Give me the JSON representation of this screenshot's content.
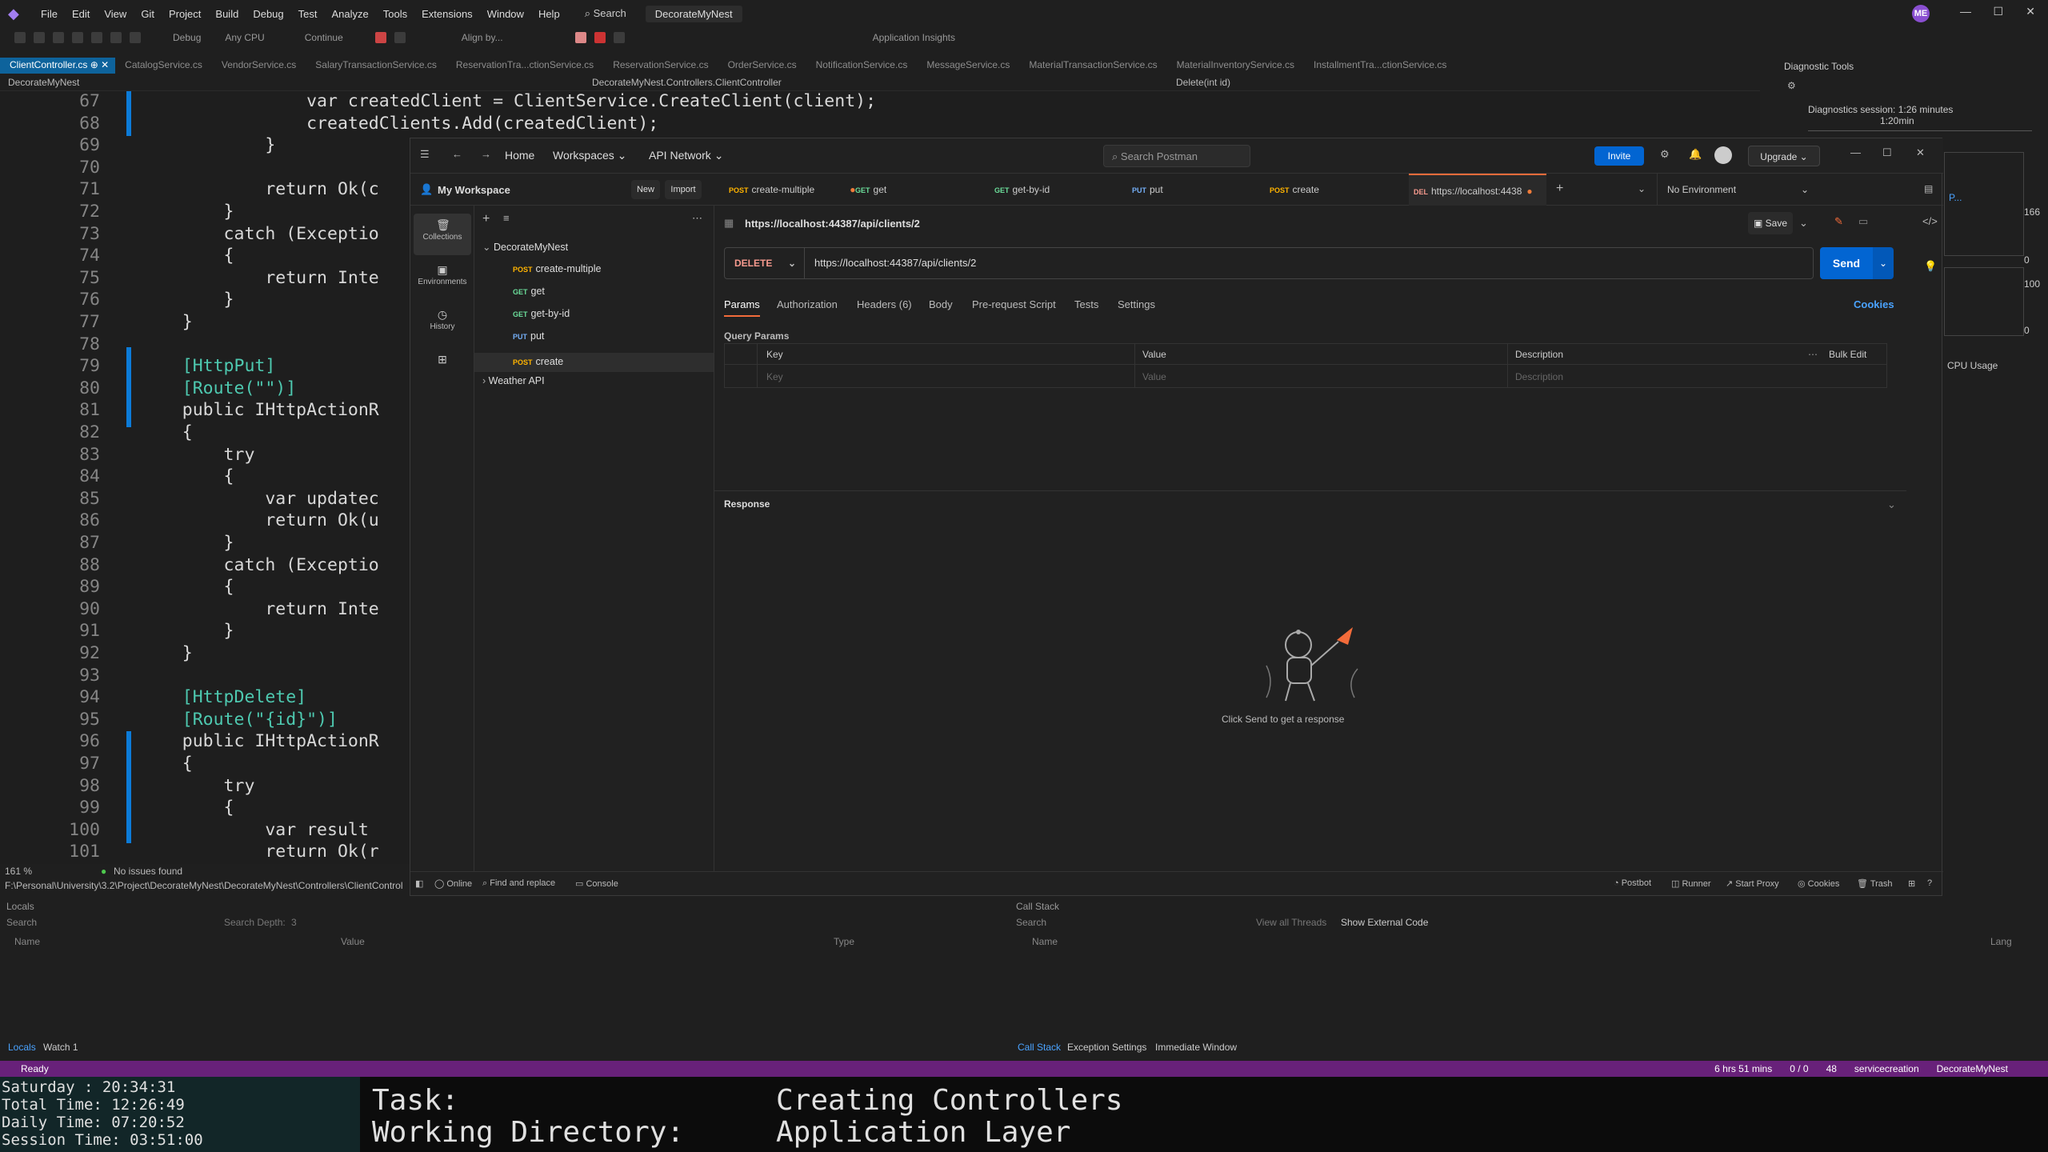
{
  "menu": {
    "items": [
      "File",
      "Edit",
      "View",
      "Git",
      "Project",
      "Build",
      "Debug",
      "Test",
      "Analyze",
      "Tools",
      "Extensions",
      "Window",
      "Help"
    ],
    "search": "Search",
    "solution": "DecorateMyNest",
    "user_initials": "ME"
  },
  "toolbar": {
    "config": "Debug",
    "platform": "Any CPU",
    "continue": "Continue",
    "align": "Align by...",
    "insights": "Application Insights"
  },
  "doc_tabs": [
    "ClientController.cs",
    "CatalogService.cs",
    "VendorService.cs",
    "SalaryTransactionService.cs",
    "ReservationTra...ctionService.cs",
    "ReservationService.cs",
    "OrderService.cs",
    "NotificationService.cs",
    "MessageService.cs",
    "MaterialTransactionService.cs",
    "MaterialInventoryService.cs",
    "InstallmentTra...ctionService.cs"
  ],
  "navbar": {
    "project": "DecorateMyNest",
    "class": "DecorateMyNest.Controllers.ClientController",
    "member": "Delete(int id)"
  },
  "editor": {
    "lines": [
      {
        "n": "67",
        "t": "                var createdClient = ClientService.CreateClient(client);"
      },
      {
        "n": "68",
        "t": "                createdClients.Add(createdClient);"
      },
      {
        "n": "69",
        "t": "            }"
      },
      {
        "n": "70",
        "t": ""
      },
      {
        "n": "71",
        "t": "            return Ok(c"
      },
      {
        "n": "72",
        "t": "        }"
      },
      {
        "n": "73",
        "t": "        catch (Exceptio"
      },
      {
        "n": "74",
        "t": "        {"
      },
      {
        "n": "75",
        "t": "            return Inte"
      },
      {
        "n": "76",
        "t": "        }"
      },
      {
        "n": "77",
        "t": "    }"
      },
      {
        "n": "78",
        "t": ""
      },
      {
        "n": "79",
        "t": "    [HttpPut]"
      },
      {
        "n": "80",
        "t": "    [Route(\"\")]"
      },
      {
        "n": "81",
        "t": "    public IHttpActionR"
      },
      {
        "n": "82",
        "t": "    {"
      },
      {
        "n": "83",
        "t": "        try"
      },
      {
        "n": "84",
        "t": "        {"
      },
      {
        "n": "85",
        "t": "            var updatec"
      },
      {
        "n": "86",
        "t": "            return Ok(u"
      },
      {
        "n": "87",
        "t": "        }"
      },
      {
        "n": "88",
        "t": "        catch (Exceptio"
      },
      {
        "n": "89",
        "t": "        {"
      },
      {
        "n": "90",
        "t": "            return Inte"
      },
      {
        "n": "91",
        "t": "        }"
      },
      {
        "n": "92",
        "t": "    }"
      },
      {
        "n": "93",
        "t": ""
      },
      {
        "n": "94",
        "t": "    [HttpDelete]"
      },
      {
        "n": "95",
        "t": "    [Route(\"{id}\")]"
      },
      {
        "n": "96",
        "t": "    public IHttpActionR"
      },
      {
        "n": "97",
        "t": "    {"
      },
      {
        "n": "98",
        "t": "        try"
      },
      {
        "n": "99",
        "t": "        {"
      },
      {
        "n": "100",
        "t": "            var result "
      },
      {
        "n": "101",
        "t": "            return Ok(r"
      }
    ]
  },
  "edstatus": {
    "zoom": "161 %",
    "issues": "No issues found"
  },
  "path": "F:\\Personal\\University\\3.2\\Project\\DecorateMyNest\\DecorateMyNest\\Controllers\\ClientControl",
  "diag": {
    "title": "Diagnostic Tools",
    "session": "Diagnostics session: 1:26 minutes",
    "time_mark": "1:20min",
    "v1": "166",
    "v2": "0",
    "v3": "100",
    "v4": "0",
    "cpu": "CPU Usage",
    "proc": "P..."
  },
  "locals": {
    "title": "Locals",
    "search": "Search",
    "depth": "Search Depth:",
    "depth_val": "3",
    "cols": [
      "Name",
      "Value",
      "Type"
    ],
    "tabs": [
      "Locals",
      "Watch 1"
    ]
  },
  "callstack": {
    "title": "Call Stack",
    "search": "Search",
    "view_threads": "View all Threads",
    "external": "Show External Code",
    "cols": [
      "Name",
      "Lang"
    ],
    "tabs": [
      "Call Stack",
      "Exception Settings",
      "Immediate Window"
    ]
  },
  "status": {
    "ready": "Ready",
    "time": "6 hrs 51 mins",
    "changes": "0 / 0",
    "edits": "48",
    "branch": "servicecreation",
    "repo": "DecorateMyNest"
  },
  "terminal": {
    "clock": [
      "Saturday  :  20:34:31",
      "Total Time: 12:26:49",
      "Daily Time: 07:20:52",
      "Session Time: 03:51:00"
    ],
    "task_label": "Task:",
    "task_value": "Creating Controllers",
    "dir_label": "Working Directory:",
    "dir_value": "Application Layer"
  },
  "postman": {
    "home": "Home",
    "workspaces": "Workspaces",
    "api_network": "API Network",
    "search": "Search Postman",
    "invite": "Invite",
    "upgrade": "Upgrade",
    "workspace": "My Workspace",
    "new": "New",
    "import": "Import",
    "rail": [
      "Collections",
      "Environments",
      "History"
    ],
    "tabs": [
      {
        "m": "POST",
        "n": "create-multiple"
      },
      {
        "m": "GET",
        "n": "get"
      },
      {
        "m": "GET",
        "n": "get-by-id"
      },
      {
        "m": "PUT",
        "n": "put"
      },
      {
        "m": "POST",
        "n": "create"
      },
      {
        "m": "DEL",
        "n": "https://localhost:4438"
      }
    ],
    "env": "No Environment",
    "collection": "DecorateMyNest",
    "requests": [
      {
        "m": "POST",
        "n": "create-multiple"
      },
      {
        "m": "GET",
        "n": "get"
      },
      {
        "m": "GET",
        "n": "get-by-id"
      },
      {
        "m": "PUT",
        "n": "put"
      },
      {
        "m": "POST",
        "n": "create"
      }
    ],
    "collection2": "Weather API",
    "req_title": "https://localhost:44387/api/clients/2",
    "save": "Save",
    "method": "DELETE",
    "url": "https://localhost:44387/api/clients/2",
    "send": "Send",
    "subtabs": [
      "Params",
      "Authorization",
      "Headers (6)",
      "Body",
      "Pre-request Script",
      "Tests",
      "Settings"
    ],
    "cookies": "Cookies",
    "query_params": "Query Params",
    "cols": [
      "Key",
      "Value",
      "Description"
    ],
    "bulk": "Bulk Edit",
    "ph": [
      "Key",
      "Value",
      "Description"
    ],
    "response": "Response",
    "empty": "Click Send to get a response",
    "footer": [
      "Online",
      "Find and replace",
      "Console"
    ],
    "footer_right": [
      "Postbot",
      "Runner",
      "Start Proxy",
      "Cookies",
      "Trash"
    ]
  }
}
